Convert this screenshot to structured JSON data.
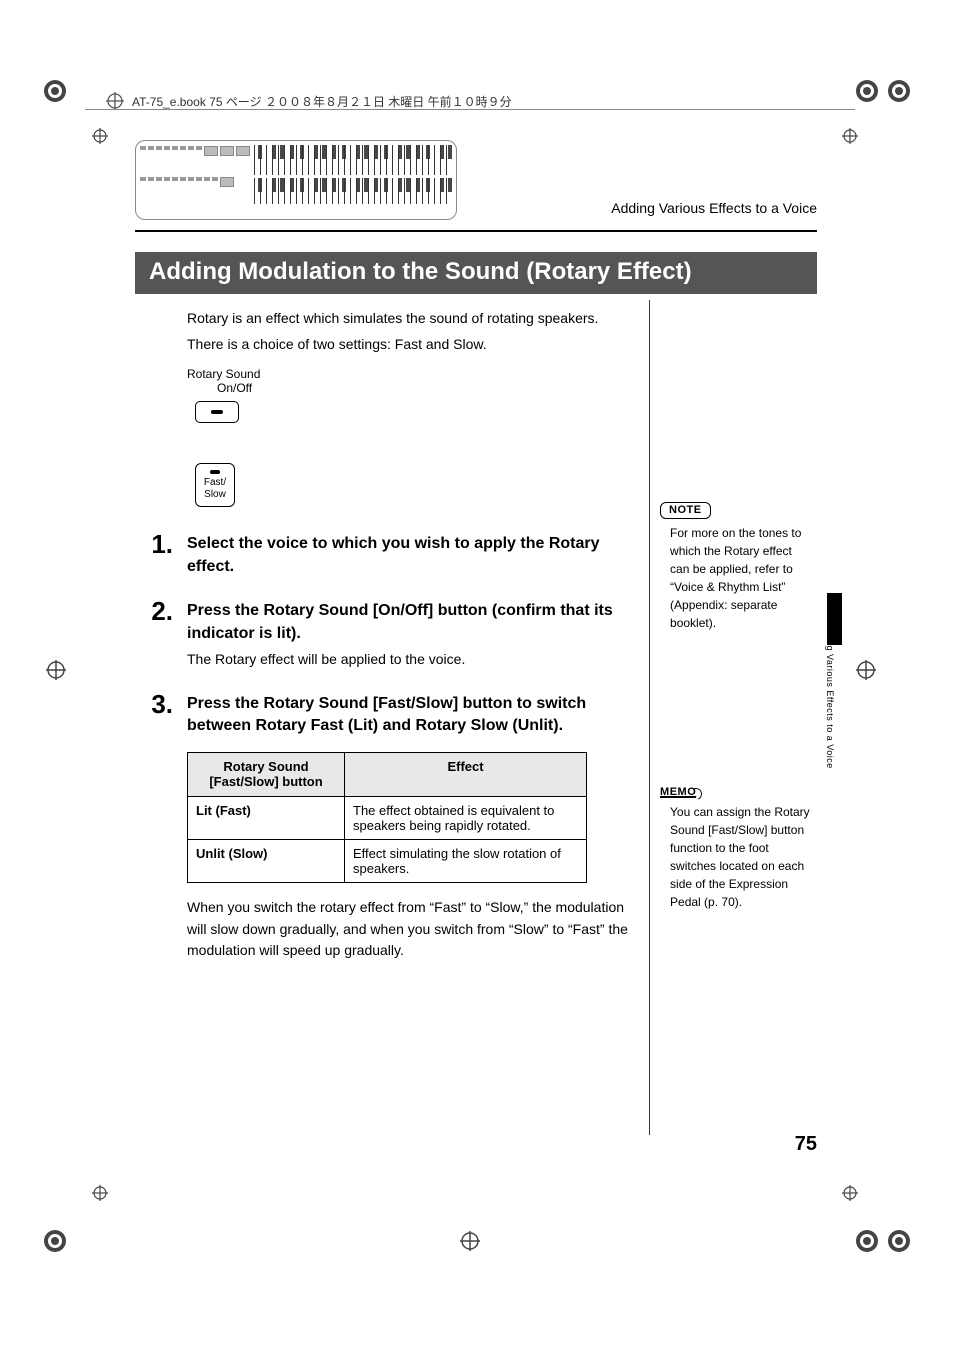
{
  "header": {
    "file_info": "AT-75_e.book 75 ページ ２００８年８月２１日 木曜日 午前１０時９分"
  },
  "section_label": "Adding Various Effects to a Voice",
  "section_title": "Adding Modulation to the Sound (Rotary Effect)",
  "intro": {
    "line1": "Rotary is an effect which simulates the sound of rotating speakers.",
    "line2": "There is a choice of two settings: Fast and Slow."
  },
  "rotary_sound": {
    "label": "Rotary Sound",
    "onoff": "On/Off",
    "fastslow": {
      "line1": "Fast/",
      "line2": "Slow"
    }
  },
  "steps": [
    {
      "num": "1.",
      "title": "Select the voice to which you wish to apply the Rotary effect."
    },
    {
      "num": "2.",
      "title": "Press the Rotary Sound [On/Off] button (confirm that its indicator is lit).",
      "text": "The Rotary effect will be applied to the voice."
    },
    {
      "num": "3.",
      "title": "Press the Rotary Sound [Fast/Slow] button to switch between Rotary Fast (Lit) and Rotary Slow (Unlit)."
    }
  ],
  "table": {
    "headers": {
      "col1": "Rotary Sound\n[Fast/Slow] button",
      "col2": "Effect"
    },
    "rows": [
      {
        "key": "Lit (Fast)",
        "effect": "The effect obtained is equivalent to speakers being rapidly rotated."
      },
      {
        "key": "Unlit (Slow)",
        "effect": "Effect simulating the slow rotation of speakers."
      }
    ]
  },
  "after_table": "When you switch the rotary effect from “Fast” to “Slow,” the modulation will slow down gradually, and when you switch from “Slow” to “Fast” the modulation will speed up gradually.",
  "side": {
    "note_badge": "NOTE",
    "note_text": "For more on the tones to which the Rotary effect can be applied, refer to “Voice & Rhythm List” (Appendix: separate booklet).",
    "memo_badge": "MEMO",
    "memo_text": "You can assign the Rotary Sound [Fast/Slow] button function to the foot switches located on each side of the Expression Pedal (p. 70)."
  },
  "vert_header": "Adding Various Effects to a Voice",
  "page_number": "75"
}
